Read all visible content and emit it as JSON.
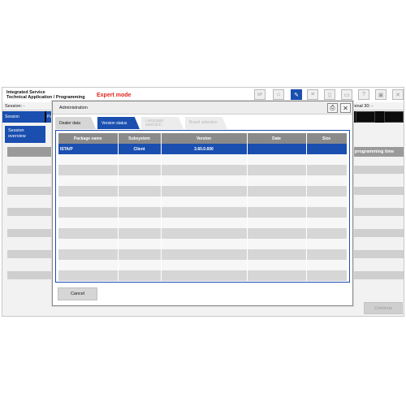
{
  "app": {
    "title_line1": "Integrated Service",
    "title_line2": "Technical Application / Programming",
    "mode": "Expert mode",
    "session_label": "Session:  -",
    "terminal_label": "Terminal 30:  -",
    "nav_session": "Session",
    "nav_pe": "Pe",
    "session_overview_line1": "Session",
    "session_overview_line2": "overview",
    "right_column_header": "g programming time",
    "continue_label": "Continue",
    "toolbar_xp_label": "XP",
    "toolbar_icons": [
      "xp-icon",
      "home-icon",
      "wrench-icon",
      "list-icon",
      "clipboard-icon",
      "document-icon",
      "printer-icon",
      "help-icon",
      "window-icon",
      "close-icon"
    ]
  },
  "dialog": {
    "title": "Administration",
    "print_icon": "printer-icon",
    "close_icon": "close-icon",
    "tabs": [
      {
        "label": "Dealer data",
        "state": "normal"
      },
      {
        "label": "Version status",
        "state": "active"
      },
      {
        "label": "Language selection",
        "state": "disabled"
      },
      {
        "label": "Brand selection",
        "state": "disabled"
      }
    ],
    "table": {
      "columns": [
        "Package name",
        "Subsystem",
        "Version",
        "Date",
        "Size"
      ],
      "rows": [
        {
          "package": "ISTA/P",
          "subsystem": "Client",
          "version": "3.60.0.600",
          "date": "",
          "size": ""
        }
      ]
    },
    "cancel_label": "Cancel"
  },
  "colors": {
    "accent": "#1a4fb0",
    "expert_mode": "#e0261b",
    "header_gray": "#8a8a8a"
  }
}
